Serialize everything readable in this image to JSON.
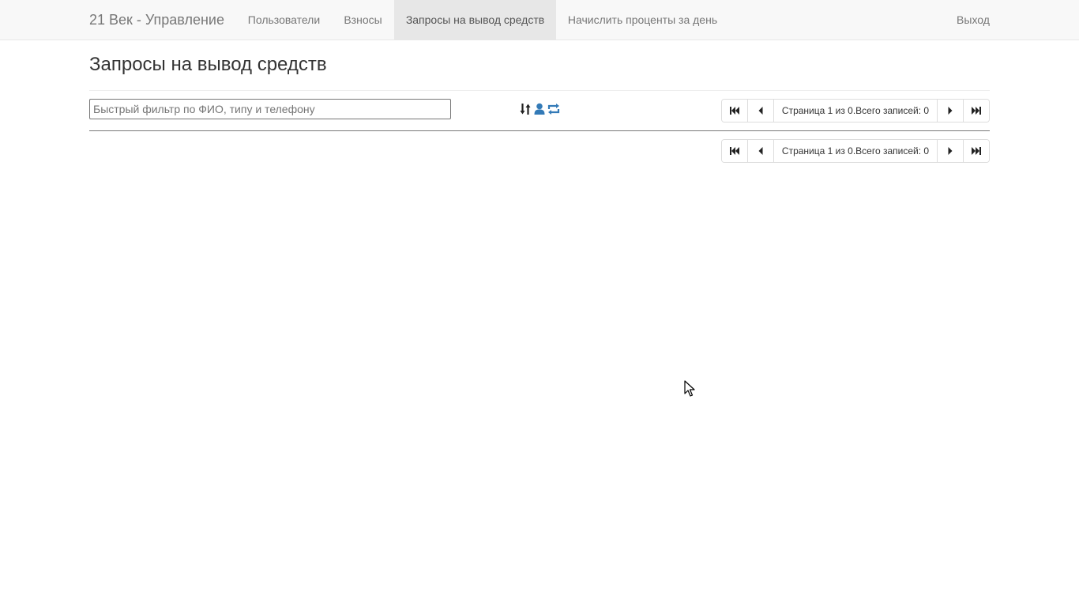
{
  "navbar": {
    "brand": "21 Век - Управление",
    "items": [
      {
        "label": "Пользователи",
        "active": false
      },
      {
        "label": "Взносы",
        "active": false
      },
      {
        "label": "Запросы на вывод средств",
        "active": true
      },
      {
        "label": "Начислить проценты за день",
        "active": false
      }
    ],
    "logout": "Выход"
  },
  "page": {
    "title": "Запросы на вывод средств"
  },
  "filter": {
    "value": "",
    "placeholder": "Быстрый фильтр по ФИО, типу и телефону"
  },
  "toolbar": {
    "icons": [
      "sort-icon",
      "user-icon",
      "refresh-icon"
    ],
    "accent_color": "#337ab7"
  },
  "pagination": {
    "top": {
      "info": "Страница 1 из 0.Всего записей: 0"
    },
    "bottom": {
      "info": "Страница 1 из 0.Всего записей: 0"
    }
  }
}
